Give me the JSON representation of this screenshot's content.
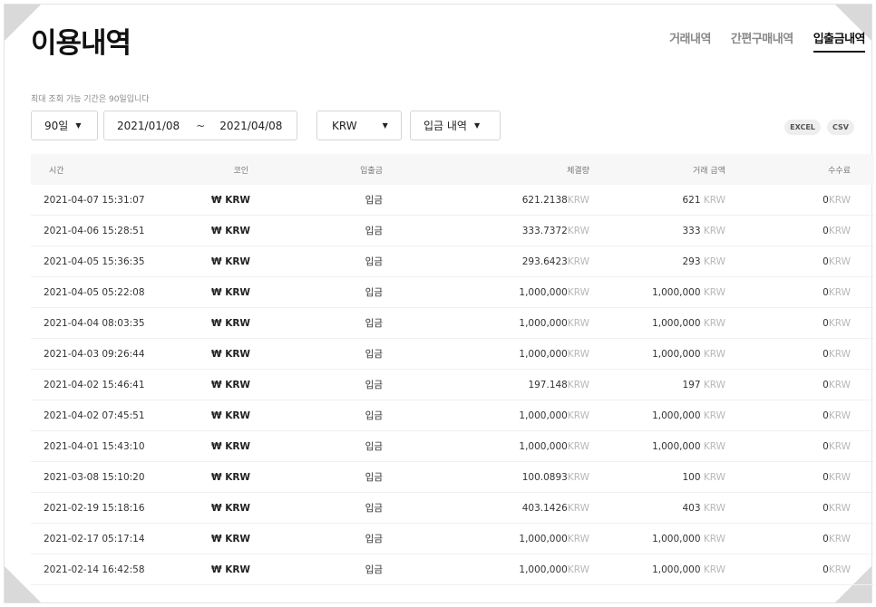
{
  "header": {
    "title": "이용내역"
  },
  "tabs": [
    {
      "label": "거래내역",
      "active": false
    },
    {
      "label": "간편구매내역",
      "active": false
    },
    {
      "label": "입출금내역",
      "active": true
    }
  ],
  "filters": {
    "notice": "최대 조회 가능 기간은 90일입니다",
    "period": "90일",
    "start_date": "2021/01/08",
    "separator": "~",
    "end_date": "2021/04/08",
    "currency": "KRW",
    "type": "입금 내역",
    "export_excel": "EXCEL",
    "export_csv": "CSV"
  },
  "table": {
    "columns": [
      "시간",
      "코인",
      "입출금",
      "체결량",
      "거래 금액",
      "수수료"
    ],
    "unit": "KRW",
    "rows": [
      {
        "time": "2021-04-07 15:31:07",
        "coin": "₩ KRW",
        "type": "입금",
        "qty": "621.2138",
        "amount": "621",
        "fee": "0"
      },
      {
        "time": "2021-04-06 15:28:51",
        "coin": "₩ KRW",
        "type": "입금",
        "qty": "333.7372",
        "amount": "333",
        "fee": "0"
      },
      {
        "time": "2021-04-05 15:36:35",
        "coin": "₩ KRW",
        "type": "입금",
        "qty": "293.6423",
        "amount": "293",
        "fee": "0"
      },
      {
        "time": "2021-04-05 05:22:08",
        "coin": "₩ KRW",
        "type": "입금",
        "qty": "1,000,000",
        "amount": "1,000,000",
        "fee": "0"
      },
      {
        "time": "2021-04-04 08:03:35",
        "coin": "₩ KRW",
        "type": "입금",
        "qty": "1,000,000",
        "amount": "1,000,000",
        "fee": "0"
      },
      {
        "time": "2021-04-03 09:26:44",
        "coin": "₩ KRW",
        "type": "입금",
        "qty": "1,000,000",
        "amount": "1,000,000",
        "fee": "0"
      },
      {
        "time": "2021-04-02 15:46:41",
        "coin": "₩ KRW",
        "type": "입금",
        "qty": "197.148",
        "amount": "197",
        "fee": "0"
      },
      {
        "time": "2021-04-02 07:45:51",
        "coin": "₩ KRW",
        "type": "입금",
        "qty": "1,000,000",
        "amount": "1,000,000",
        "fee": "0"
      },
      {
        "time": "2021-04-01 15:43:10",
        "coin": "₩ KRW",
        "type": "입금",
        "qty": "1,000,000",
        "amount": "1,000,000",
        "fee": "0"
      },
      {
        "time": "2021-03-08 15:10:20",
        "coin": "₩ KRW",
        "type": "입금",
        "qty": "100.0893",
        "amount": "100",
        "fee": "0"
      },
      {
        "time": "2021-02-19 15:18:16",
        "coin": "₩ KRW",
        "type": "입금",
        "qty": "403.1426",
        "amount": "403",
        "fee": "0"
      },
      {
        "time": "2021-02-17 05:17:14",
        "coin": "₩ KRW",
        "type": "입금",
        "qty": "1,000,000",
        "amount": "1,000,000",
        "fee": "0"
      },
      {
        "time": "2021-02-14 16:42:58",
        "coin": "₩ KRW",
        "type": "입금",
        "qty": "1,000,000",
        "amount": "1,000,000",
        "fee": "0"
      }
    ]
  },
  "icons": {
    "caret": "caret-down-icon"
  }
}
